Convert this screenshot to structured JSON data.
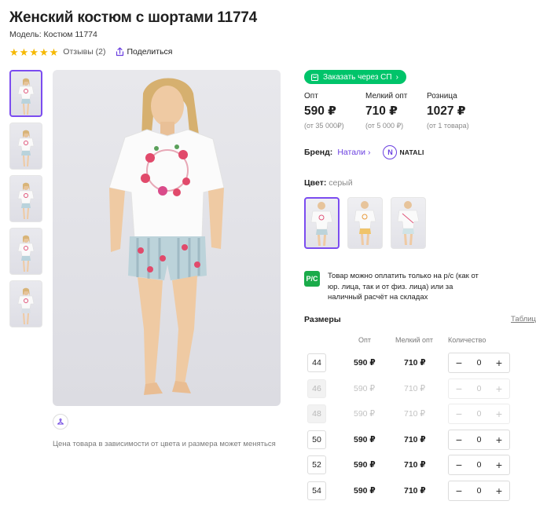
{
  "product": {
    "title": "Женский костюм с шортами 11774",
    "model": "Модель: Костюм 11774",
    "rating_stars": 5,
    "reviews": "Отзывы (2)",
    "share": "Поделиться"
  },
  "gallery": {
    "thumb_count": 5,
    "active_index": 0,
    "price_note": "Цена товара в зависимости от цвета и размера может меняться"
  },
  "order": {
    "sp_button": "Заказать через СП"
  },
  "prices": [
    {
      "label": "Опт",
      "value": "590 ₽",
      "sub": "(от 35 000₽)"
    },
    {
      "label": "Мелкий опт",
      "value": "710 ₽",
      "sub": "(от 5 000 ₽)"
    },
    {
      "label": "Розница",
      "value": "1027 ₽",
      "sub": "(от 1 товара)"
    }
  ],
  "brand": {
    "label": "Бренд:",
    "name": "Натали",
    "logo_letter": "N",
    "logo_text": "NATALI"
  },
  "color": {
    "label": "Цвет:",
    "value": "серый"
  },
  "payment": {
    "icon_text": "Р/С",
    "text": "Товар можно оплатить только на р/с (как от юр. лица, так и от физ. лица) или за наличный расчёт на складах"
  },
  "sizes": {
    "title": "Размеры",
    "table_link": "Таблиц",
    "headers": {
      "opt": "Опт",
      "small_opt": "Мелкий опт",
      "qty": "Количество"
    },
    "rows": [
      {
        "size": "44",
        "opt": "590 ₽",
        "small_opt": "710 ₽",
        "qty": "0",
        "available": true
      },
      {
        "size": "46",
        "opt": "590 ₽",
        "small_opt": "710 ₽",
        "qty": "0",
        "available": false
      },
      {
        "size": "48",
        "opt": "590 ₽",
        "small_opt": "710 ₽",
        "qty": "0",
        "available": false
      },
      {
        "size": "50",
        "opt": "590 ₽",
        "small_opt": "710 ₽",
        "qty": "0",
        "available": true
      },
      {
        "size": "52",
        "opt": "590 ₽",
        "small_opt": "710 ₽",
        "qty": "0",
        "available": true
      },
      {
        "size": "54",
        "opt": "590 ₽",
        "small_opt": "710 ₽",
        "qty": "0",
        "available": true
      }
    ]
  },
  "colors_ui": {
    "accent": "#7b4cf0",
    "green": "#00c46a",
    "star": "#f5b800"
  }
}
